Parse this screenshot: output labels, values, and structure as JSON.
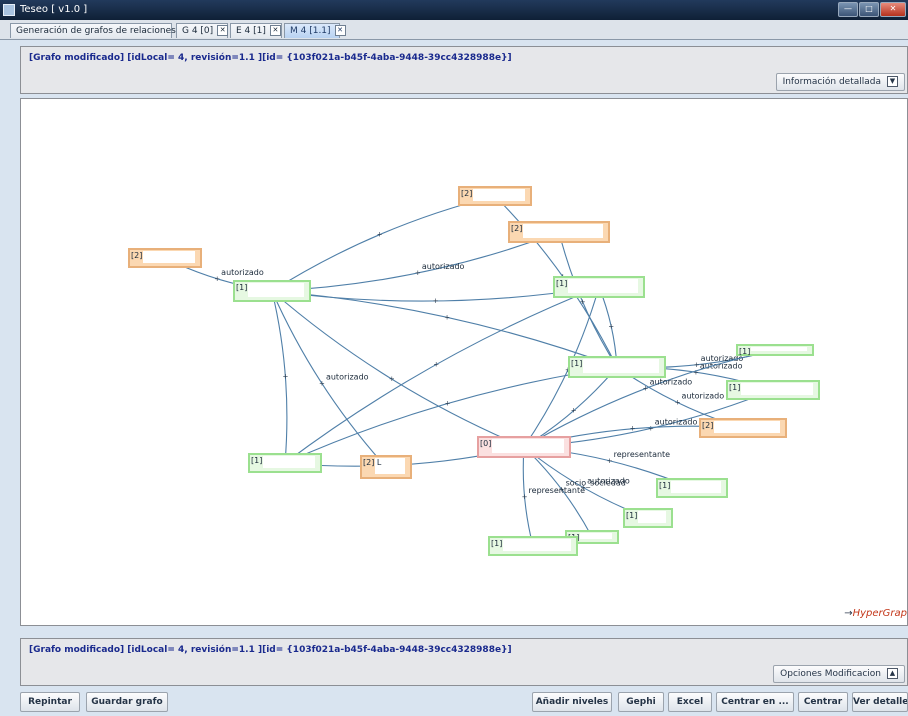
{
  "window": {
    "title": "Teseo  [ v1.0 ]"
  },
  "tabs": [
    {
      "label": "Generación de grafos de relaciones",
      "closable": false
    },
    {
      "label": "G 4 [0]",
      "closable": true
    },
    {
      "label": "E 4 [1]",
      "closable": true
    },
    {
      "label": "M 4 [1.1]",
      "closable": true,
      "active": true
    }
  ],
  "top_info": {
    "text": "[Grafo modificado] [idLocal= 4, revisión=1.1 ][id= {103f021a-b45f-4aba-9448-39cc4328988e}]",
    "detail_button": "Información detallada"
  },
  "bottom_info": {
    "text": "[Grafo modificado] [idLocal= 4, revisión=1.1 ][id= {103f021a-b45f-4aba-9448-39cc4328988e}]",
    "options_button": "Opciones Modificacion"
  },
  "brand": {
    "arrow": "→",
    "name": "HyperGrap"
  },
  "graph": {
    "nodes": [
      {
        "id": "n1",
        "label": "[2]",
        "color": "orange"
      },
      {
        "id": "n2",
        "label": "[2]",
        "color": "orange"
      },
      {
        "id": "n3",
        "label": "[2]",
        "color": "orange"
      },
      {
        "id": "n4",
        "label": "[1]",
        "color": "green"
      },
      {
        "id": "n5",
        "label": "[1]",
        "color": "green"
      },
      {
        "id": "n6",
        "label": "[1]",
        "color": "green"
      },
      {
        "id": "n7",
        "label": "[1]",
        "color": "green"
      },
      {
        "id": "n8",
        "label": "[1]",
        "color": "green"
      },
      {
        "id": "n9",
        "label": "[2]",
        "color": "orange"
      },
      {
        "id": "n10",
        "label": "[1]",
        "color": "green"
      },
      {
        "id": "n11",
        "label": "[2] L",
        "color": "orange"
      },
      {
        "id": "n12",
        "label": "[0]",
        "color": "pink"
      },
      {
        "id": "n13",
        "label": "[1]",
        "color": "green"
      },
      {
        "id": "n14",
        "label": "[1]",
        "color": "green"
      },
      {
        "id": "n15",
        "label": "[1]",
        "color": "green"
      },
      {
        "id": "n16",
        "label": "[1]",
        "color": "green"
      }
    ],
    "edges": [
      {
        "from": "n4",
        "to": "n1",
        "label": ""
      },
      {
        "from": "n4",
        "to": "n2",
        "label": "autorizado"
      },
      {
        "from": "n4",
        "to": "n3",
        "label": "autorizado"
      },
      {
        "from": "n4",
        "to": "n5",
        "label": ""
      },
      {
        "from": "n4",
        "to": "n6",
        "label": ""
      },
      {
        "from": "n4",
        "to": "n12",
        "label": ""
      },
      {
        "from": "n4",
        "to": "n10",
        "label": ""
      },
      {
        "from": "n4",
        "to": "n11",
        "label": "autorizado"
      },
      {
        "from": "n1",
        "to": "n6",
        "label": ""
      },
      {
        "from": "n2",
        "to": "n6",
        "label": ""
      },
      {
        "from": "n5",
        "to": "n6",
        "label": ""
      },
      {
        "from": "n5",
        "to": "n10",
        "label": ""
      },
      {
        "from": "n5",
        "to": "n12",
        "label": ""
      },
      {
        "from": "n6",
        "to": "n10",
        "label": ""
      },
      {
        "from": "n6",
        "to": "n12",
        "label": ""
      },
      {
        "from": "n6",
        "to": "n7",
        "label": "autorizado"
      },
      {
        "from": "n6",
        "to": "n8",
        "label": "autorizado"
      },
      {
        "from": "n6",
        "to": "n9",
        "label": "autorizado"
      },
      {
        "from": "n12",
        "to": "n7",
        "label": "autorizado"
      },
      {
        "from": "n12",
        "to": "n8",
        "label": "autorizado"
      },
      {
        "from": "n12",
        "to": "n9",
        "label": ""
      },
      {
        "from": "n10",
        "to": "n12",
        "label": ""
      },
      {
        "from": "n12",
        "to": "n13",
        "label": "representante"
      },
      {
        "from": "n12",
        "to": "n14",
        "label": "autorizado"
      },
      {
        "from": "n12",
        "to": "n15",
        "label": "socio_sociedad"
      },
      {
        "from": "n12",
        "to": "n16",
        "label": "representante"
      }
    ]
  },
  "bottom_buttons": {
    "repaint": "Repintar",
    "save": "Guardar grafo",
    "add_levels": "Añadir niveles",
    "gephi": "Gephi",
    "excel": "Excel",
    "center_on": "Centrar en ...",
    "center": "Centrar",
    "details": "Ver detalles"
  },
  "colors": {
    "edge": "#4f7fa8",
    "node_green_border": "#9be08f",
    "node_orange_border": "#e8b07a",
    "node_pink_border": "#e6a0a0",
    "info_text": "#1a2a8e"
  }
}
